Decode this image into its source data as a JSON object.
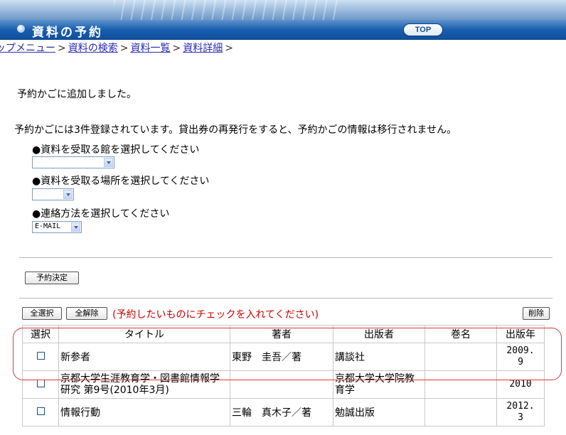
{
  "header": {
    "title": "資料の予約",
    "top_button": "TOP"
  },
  "breadcrumb": {
    "items": [
      "ップメニュー",
      "資料の検索",
      "資料一覧",
      "資料詳細"
    ],
    "separator": ">"
  },
  "messages": {
    "added": "予約かごに追加しました。",
    "count_notice": "予約かごには3件登録されています。貸出券の再発行をすると、予約かごの情報は移行されません。"
  },
  "form": {
    "library_label": "●資料を受取る館を選択してください",
    "library_value": "",
    "place_label": "●資料を受取る場所を選択してください",
    "place_value": "",
    "contact_label": "●連絡方法を選択してください",
    "contact_value": "E-MAIL"
  },
  "actions": {
    "confirm": "予約決定",
    "select_all": "全選択",
    "deselect_all": "全解除",
    "hint": "(予約したいものにチェックを入れてください)",
    "delete": "削除"
  },
  "table": {
    "headers": [
      "選択",
      "タイトル",
      "著者",
      "出版者",
      "巻名",
      "出版年"
    ],
    "rows": [
      {
        "title": "新参者",
        "author": "東野　圭吾／著",
        "publisher": "講談社",
        "volume": "",
        "year": "2009.\n9"
      },
      {
        "title": "京都大学生涯教育学・図書館情報学研究 第9号(2010年3月)",
        "author": "",
        "publisher": "京都大学大学院教育学",
        "volume": "",
        "year": "2010"
      },
      {
        "title": "情報行動",
        "author": "三輪　真木子／著",
        "publisher": "勉誠出版",
        "volume": "",
        "year": "2012.\n3"
      }
    ]
  },
  "colors": {
    "title_bar": "#1a5fae",
    "link": "#2a2ab5",
    "hint": "#cc0000",
    "highlight": "#d93a3a"
  }
}
